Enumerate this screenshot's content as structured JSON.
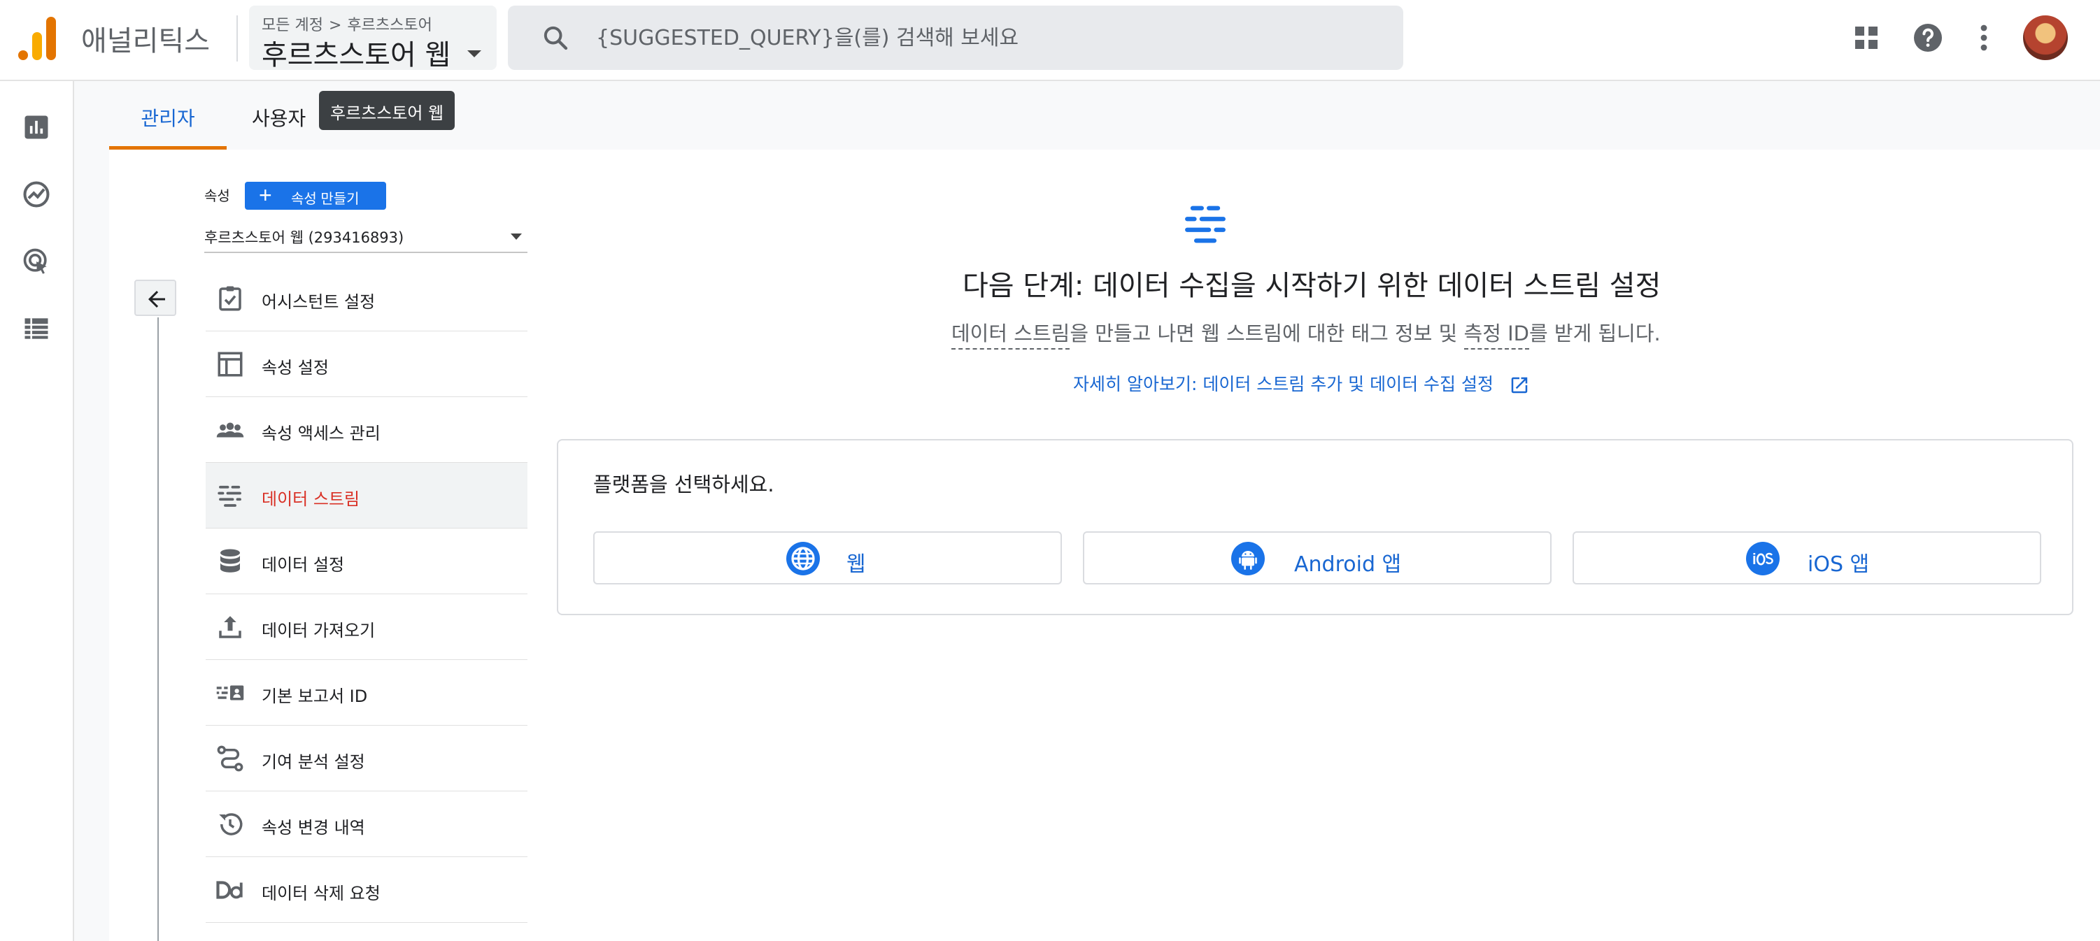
{
  "app": {
    "name": "애널리틱스"
  },
  "account": {
    "crumb_all": "모든 계정",
    "crumb_sep": ">",
    "crumb_account": "후르츠스토어",
    "property_name": "후르츠스토어 웹"
  },
  "search": {
    "placeholder": "{SUGGESTED_QUERY}을(를) 검색해 보세요"
  },
  "tabs": [
    {
      "label": "관리자",
      "active": true
    },
    {
      "label": "사용자",
      "active": false
    }
  ],
  "tooltip": "후르츠스토어 웹",
  "property": {
    "label": "속성",
    "create_label": "속성 만들기",
    "selected": "후르츠스토어 웹 (293416893)"
  },
  "nav": {
    "items": [
      {
        "label": "어시스턴트 설정",
        "icon": "assistant-check-icon"
      },
      {
        "label": "속성 설정",
        "icon": "property-layout-icon"
      },
      {
        "label": "속성 액세스 관리",
        "icon": "people-icon"
      },
      {
        "label": "데이터 스트림",
        "icon": "data-streams-icon",
        "active": true
      },
      {
        "label": "데이터 설정",
        "icon": "database-icon"
      },
      {
        "label": "데이터 가져오기",
        "icon": "upload-icon"
      },
      {
        "label": "기본 보고서 ID",
        "icon": "reporting-id-icon"
      },
      {
        "label": "기여 분석 설정",
        "icon": "attribution-icon"
      },
      {
        "label": "속성 변경 내역",
        "icon": "history-icon"
      },
      {
        "label": "데이터 삭제 요청",
        "icon": "data-deletion-icon"
      }
    ]
  },
  "content": {
    "title": "다음 단계: 데이터 수집을 시작하기 위한 데이터 스트림 설정",
    "sub_part1": "데이터 스트림",
    "sub_part2": "을 만들고 나면 웹 스트림에 대한 태그 정보 및 ",
    "sub_part3": "측정 ID",
    "sub_part4": "를 받게 됩니다.",
    "learn_more": "자세히 알아보기: 데이터 스트림 추가 및 데이터 수집 설정",
    "platform_prompt": "플랫폼을 선택하세요.",
    "platforms": [
      {
        "label": "웹",
        "icon": "globe-icon"
      },
      {
        "label": "Android 앱",
        "icon": "android-icon"
      },
      {
        "label": "iOS 앱",
        "icon": "ios-icon"
      }
    ]
  },
  "colors": {
    "accent": "#1a73e8",
    "link": "#1967d2",
    "active_nav": "#d93025",
    "tab_indicator": "#e37400"
  }
}
